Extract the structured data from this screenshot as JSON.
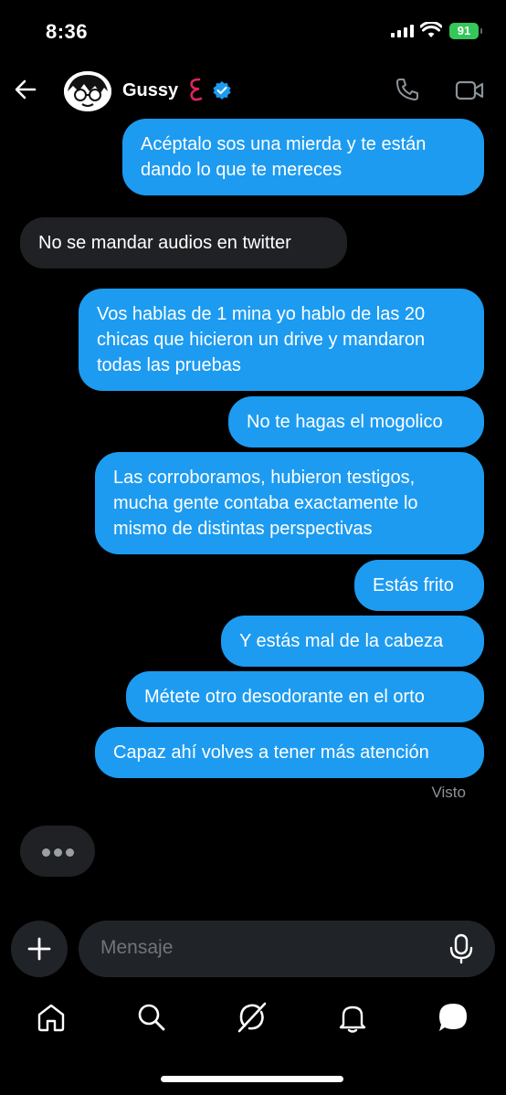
{
  "status_bar": {
    "time": "8:36",
    "battery": "91"
  },
  "header": {
    "contact_name": "Gussy"
  },
  "messages": [
    {
      "dir": "out",
      "text": "Acéptalo sos una mierda y te están dando lo que te mereces"
    },
    {
      "dir": "in",
      "text": "No se mandar audios en twitter"
    },
    {
      "dir": "out",
      "text": "Vos hablas de 1 mina yo hablo de las 20 chicas que hicieron un drive y mandaron todas las pruebas"
    },
    {
      "dir": "out",
      "text": "No te hagas el mogolico"
    },
    {
      "dir": "out",
      "text": "Las corroboramos, hubieron testigos, mucha gente contaba exactamente lo mismo de distintas perspectivas"
    },
    {
      "dir": "out",
      "text": "Estás frito"
    },
    {
      "dir": "out",
      "text": "Y estás mal de la cabeza"
    },
    {
      "dir": "out",
      "text": "Métete otro desodorante en el orto"
    },
    {
      "dir": "out",
      "text": "Capaz ahí volves a tener más atención"
    }
  ],
  "read_receipt": "Visto",
  "composer": {
    "placeholder": "Mensaje"
  },
  "tabbar": {
    "icons": [
      "home-icon",
      "search-icon",
      "grok-icon",
      "notifications-icon",
      "messages-icon"
    ]
  },
  "colors": {
    "outgoing_bubble": "#1d9bf0",
    "incoming_bubble": "#1f2124",
    "background": "#000000",
    "battery": "#35c759"
  }
}
